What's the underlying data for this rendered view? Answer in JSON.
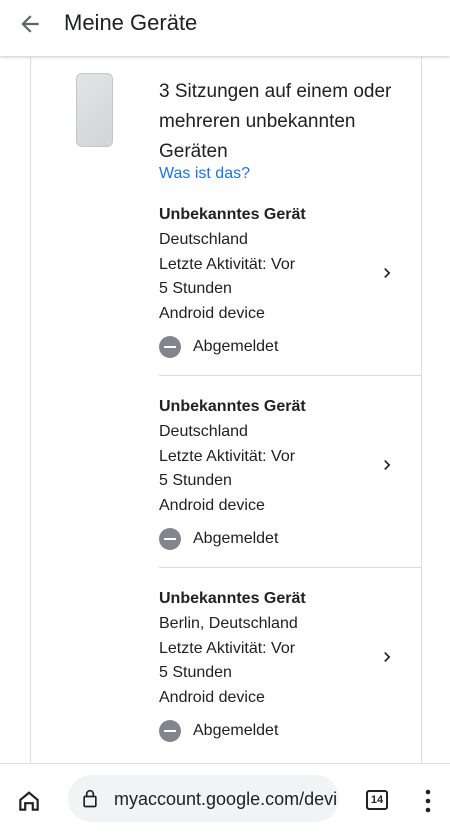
{
  "appbar": {
    "title": "Meine Geräte",
    "back_icon": "arrow-back-icon"
  },
  "group": {
    "title": "3 Sitzungen auf einem oder mehreren unbekannten Geräten",
    "link": "Was ist das?",
    "device_icon": "phone-icon"
  },
  "sessions": [
    {
      "name": "Unbekanntes Gerät",
      "location": "Deutschland",
      "activity_line1": "Letzte Aktivität: Vor",
      "activity_line2": "5 Stunden",
      "device": "Android device",
      "status": "Abgemeldet"
    },
    {
      "name": "Unbekanntes Gerät",
      "location": "Deutschland",
      "activity_line1": "Letzte Aktivität: Vor",
      "activity_line2": "5 Stunden",
      "device": "Android device",
      "status": "Abgemeldet"
    },
    {
      "name": "Unbekanntes Gerät",
      "location": "Berlin, Deutschland",
      "activity_line1": "Letzte Aktivität: Vor",
      "activity_line2": "5 Stunden",
      "device": "Android device",
      "status": "Abgemeldet"
    }
  ],
  "browser": {
    "url": "myaccount.google.com/devi",
    "tab_count": "14",
    "home_icon": "home-icon",
    "lock_icon": "lock-icon",
    "menu_icon": "more-vert-icon"
  },
  "colors": {
    "link": "#1a73e8",
    "text": "#202124",
    "status_icon": "#80868b",
    "divider": "#dadce0"
  }
}
